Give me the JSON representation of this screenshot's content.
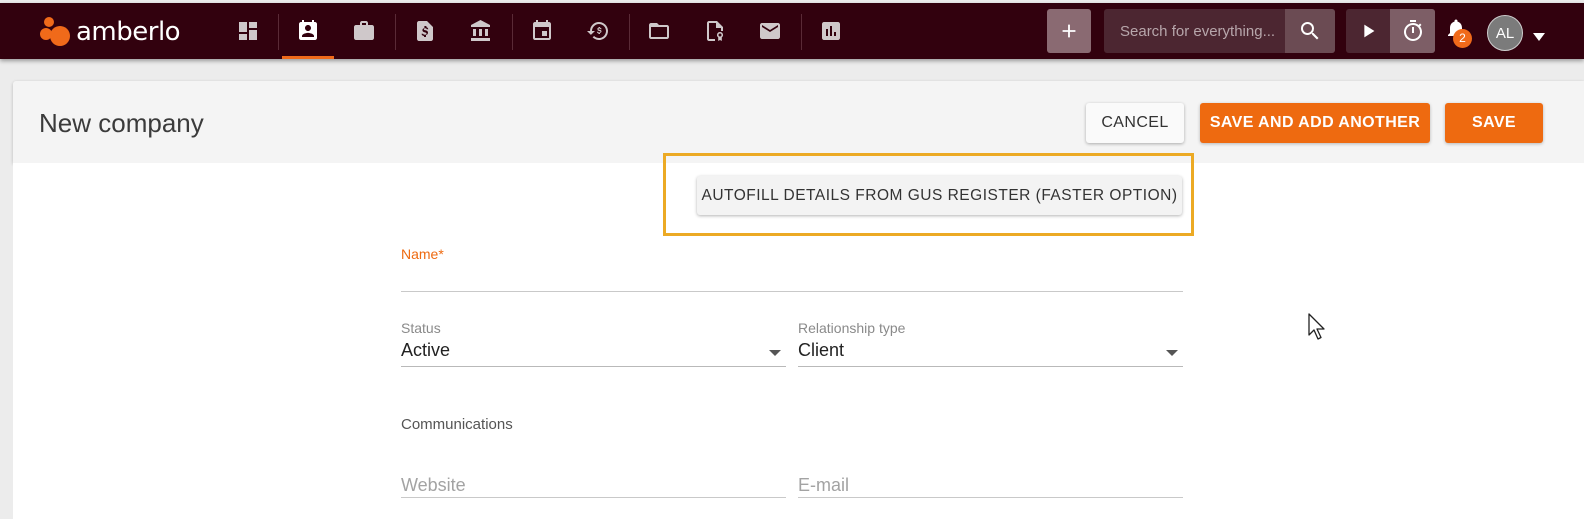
{
  "app": {
    "brand": "amberlo",
    "brand_color": "#f06a1a",
    "topbar_color": "#32010e"
  },
  "nav": {
    "items": [
      {
        "icon": "dashboard-icon"
      },
      {
        "icon": "contacts-icon",
        "active": true
      },
      {
        "icon": "briefcase-icon"
      },
      {
        "icon": "invoice-dollar-icon"
      },
      {
        "icon": "bank-icon"
      },
      {
        "icon": "calendar-icon"
      },
      {
        "icon": "time-billing-icon"
      },
      {
        "icon": "folder-icon"
      },
      {
        "icon": "document-certificate-icon"
      },
      {
        "icon": "mail-icon"
      },
      {
        "icon": "reports-chart-icon"
      }
    ],
    "search_placeholder": "Search for everything...",
    "notifications_count": "2",
    "user_initials": "AL"
  },
  "header": {
    "title": "New company",
    "cancel_label": "CANCEL",
    "save_another_label": "SAVE AND ADD ANOTHER",
    "save_label": "SAVE"
  },
  "form": {
    "autofill_label": "AUTOFILL DETAILS FROM GUS REGISTER (FASTER OPTION)",
    "name_label": "Name*",
    "name_value": "",
    "status_label": "Status",
    "status_value": "Active",
    "relationship_label": "Relationship type",
    "relationship_value": "Client",
    "communications_title": "Communications",
    "website_placeholder": "Website",
    "email_placeholder": "E-mail"
  }
}
